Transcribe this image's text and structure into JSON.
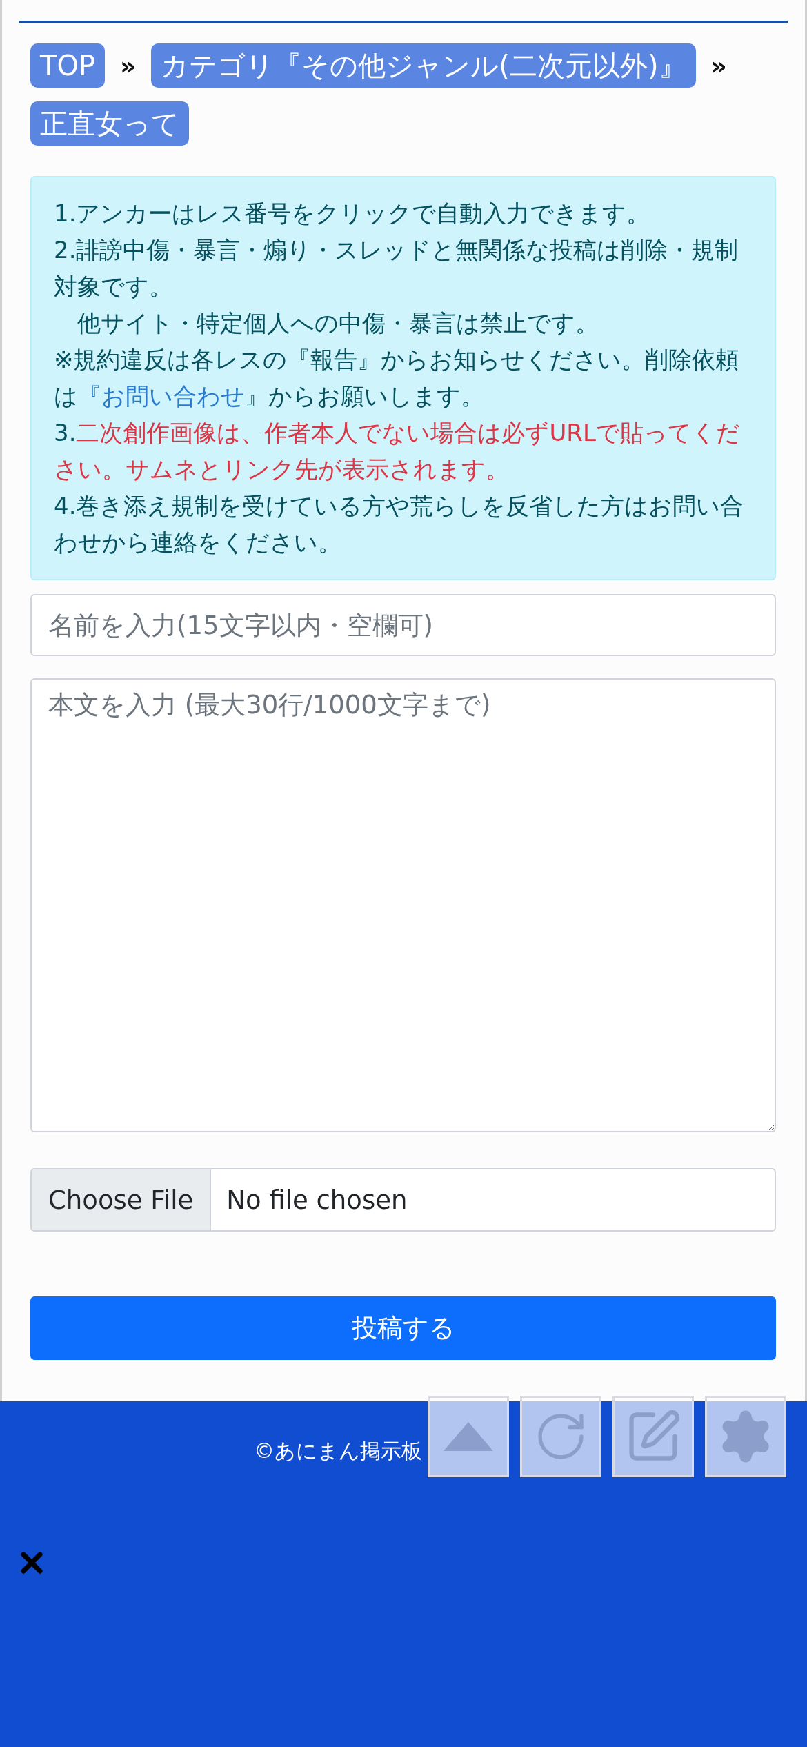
{
  "breadcrumbs": [
    {
      "label": "TOP"
    },
    {
      "label": "カテゴリ『その他ジャンル(二次元以外)』"
    },
    {
      "label": "正直女って"
    }
  ],
  "breadcrumb_separator": "»",
  "notice": {
    "paragraphs": [
      [
        {
          "kind": "text",
          "text": "1.アンカーはレス番号をクリックで自動入力できます。"
        }
      ],
      [
        {
          "kind": "text",
          "text": "2.誹謗中傷・暴言・煽り・スレッドと無関係な投稿は削除・規制対象です。"
        }
      ],
      [
        {
          "kind": "text",
          "text": "　他サイト・特定個人への中傷・暴言は禁止です。"
        }
      ],
      [
        {
          "kind": "text",
          "text": "※規約違反は各レスの『報告』からお知らせください。削除依頼は"
        },
        {
          "kind": "link",
          "text": "『お問い合わせ"
        },
        {
          "kind": "text",
          "text": "』からお願いします。"
        }
      ],
      [
        {
          "kind": "text",
          "text": "3."
        },
        {
          "kind": "warning",
          "text": "二次創作画像は、作者本人でない場合は必ずURLで貼ってください。サムネとリンク先が表示されます。"
        }
      ],
      [
        {
          "kind": "text",
          "text": "4.巻き添え規制を受けている方や荒らしを反省した方はお問い合わせから連絡をください。"
        }
      ]
    ]
  },
  "name_field": {
    "placeholder": "名前を入力(15文字以内・空欄可)"
  },
  "body_field": {
    "placeholder": "本文を入力 (最大30行/1000文字まで)"
  },
  "file_input": {
    "button": "Choose File",
    "status": "No file chosen"
  },
  "submit_button": "投稿する",
  "footer": {
    "copyright": "©あにまん掲示板"
  }
}
